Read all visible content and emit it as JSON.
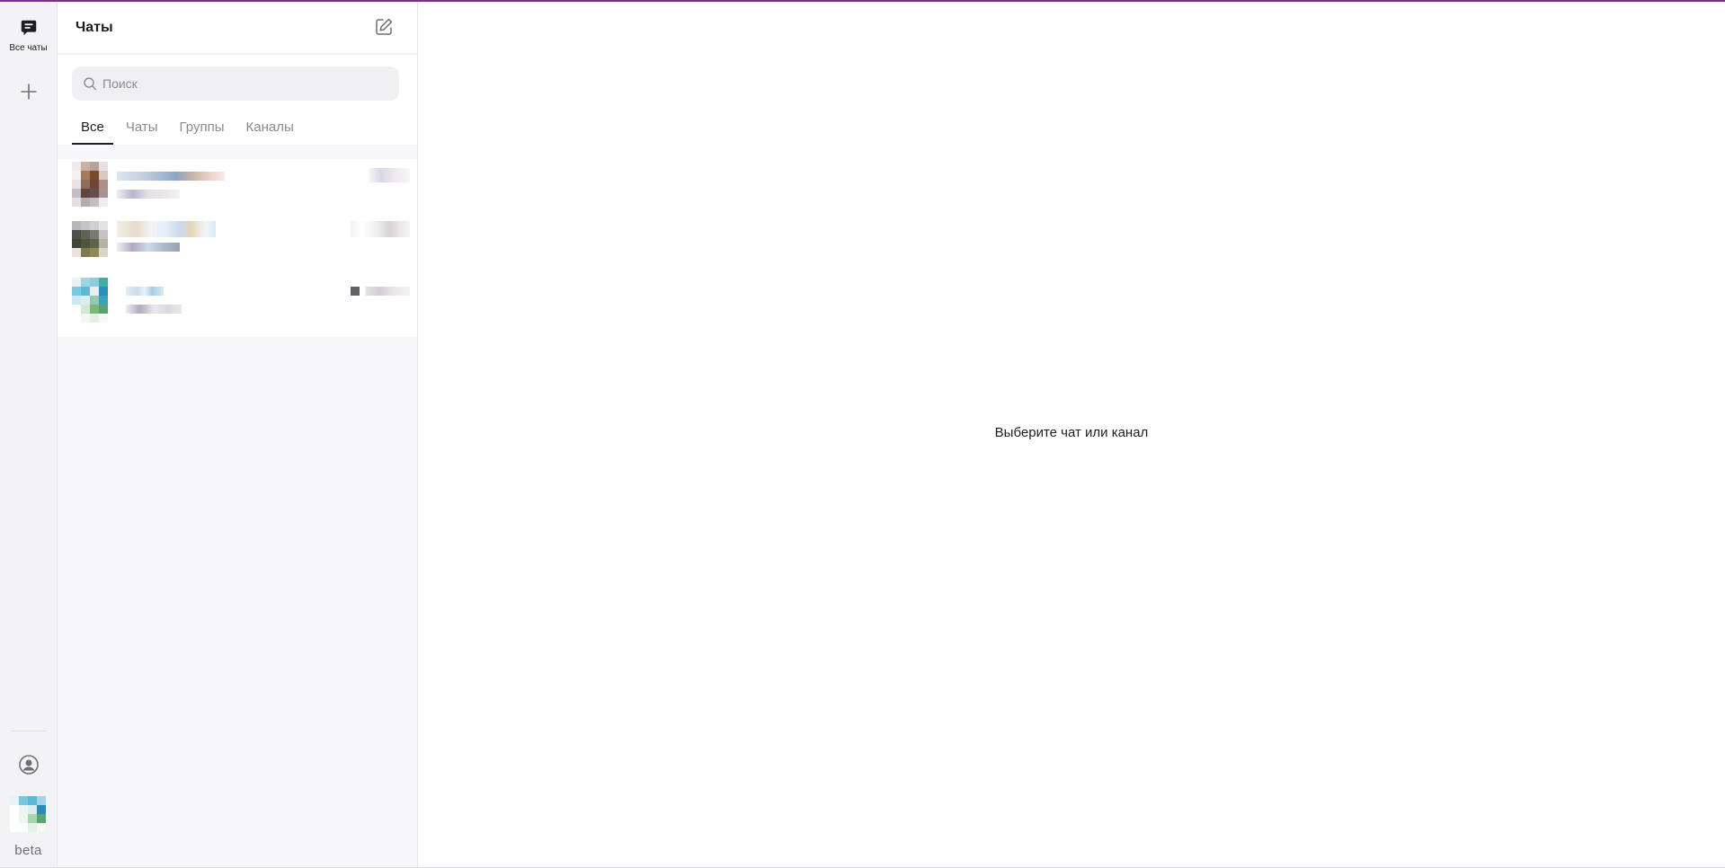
{
  "rail": {
    "all_chats_label": "Все чаты",
    "icons": [
      "chat-bubble-icon",
      "plus-icon",
      "profile-icon"
    ],
    "beta_label": "beta"
  },
  "panel": {
    "title": "Чаты",
    "search_placeholder": "Поиск",
    "tabs": [
      {
        "label": "Все",
        "active": true
      },
      {
        "label": "Чаты",
        "active": false
      },
      {
        "label": "Группы",
        "active": false
      },
      {
        "label": "Каналы",
        "active": false
      }
    ]
  },
  "main": {
    "empty_state": "Выберите чат или канал"
  },
  "colors": {
    "accent_topline": "#7b2e8e",
    "active_tab": "#1d1d1f",
    "inactive_tab": "#8a8a94"
  }
}
